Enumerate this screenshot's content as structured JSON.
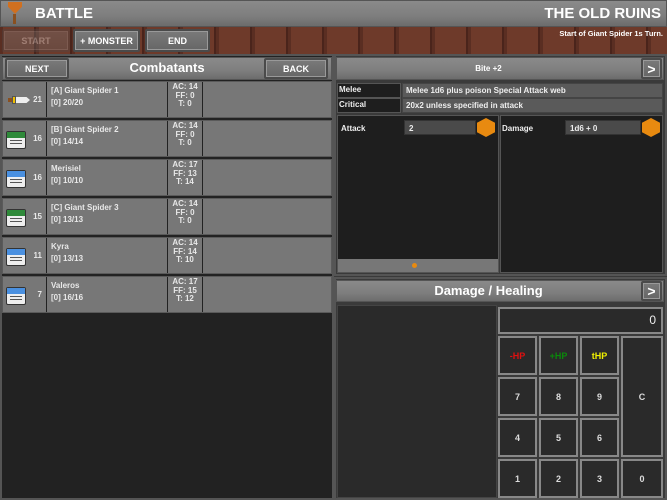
{
  "header": {
    "title": "BATTLE",
    "location": "THE OLD RUINS",
    "status": "Start of Giant Spider 1s Turn."
  },
  "toolbar": {
    "start": "START",
    "add_monster": "+ MONSTER",
    "end": "END"
  },
  "combatants": {
    "title": "Combatants",
    "next": "NEXT",
    "back": "BACK",
    "rows": [
      {
        "icon": "sword",
        "init": "21",
        "name": "[A] Giant Spider 1",
        "hp": "[0] 20/20",
        "ac": "AC: 14",
        "ff": "FF: 0",
        "t": "T: 0"
      },
      {
        "icon": "monster-card",
        "init": "16",
        "name": "[B] Giant Spider 2",
        "hp": "[0] 14/14",
        "ac": "AC: 14",
        "ff": "FF: 0",
        "t": "T: 0"
      },
      {
        "icon": "player-card",
        "init": "16",
        "name": "Merisiel",
        "hp": "[0] 10/10",
        "ac": "AC: 17",
        "ff": "FF: 13",
        "t": "T: 14"
      },
      {
        "icon": "monster-card",
        "init": "15",
        "name": "[C] Giant Spider 3",
        "hp": "[0] 13/13",
        "ac": "AC: 14",
        "ff": "FF: 0",
        "t": "T: 0"
      },
      {
        "icon": "player-card",
        "init": "11",
        "name": "Kyra",
        "hp": "[0] 13/13",
        "ac": "AC: 14",
        "ff": "FF: 14",
        "t": "T: 10"
      },
      {
        "icon": "player-card",
        "init": "7",
        "name": "Valeros",
        "hp": "[0] 16/16",
        "ac": "AC: 17",
        "ff": "FF: 15",
        "t": "T: 12"
      }
    ]
  },
  "attack": {
    "title": "Bite +2",
    "next": ">",
    "melee_label": "Melee",
    "melee_value": "Melee 1d6 plus poison Special Attack web",
    "critical_label": "Critical",
    "critical_value": "20x2 unless specified in attack",
    "attack_label": "Attack",
    "attack_value": "2",
    "damage_label": "Damage",
    "damage_value": "1d6 + 0"
  },
  "damage": {
    "title": "Damage / Healing",
    "next": ">",
    "display": "0",
    "minus_hp": "-HP",
    "plus_hp": "+HP",
    "temp_hp": "tHP",
    "clear": "C",
    "keys": [
      "7",
      "8",
      "9",
      "4",
      "5",
      "6",
      "1",
      "2",
      "3",
      "0"
    ]
  },
  "colors": {
    "minus": "#e01010",
    "plus": "#0a8a0a",
    "temp": "#f0f000",
    "die": "#e88a10"
  }
}
